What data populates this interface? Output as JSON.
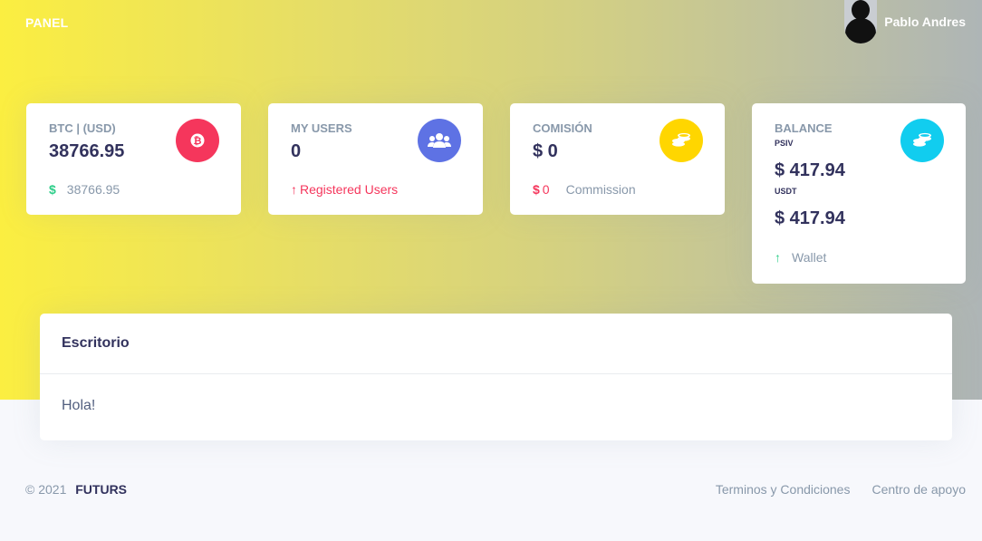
{
  "header": {
    "brand": "PANEL",
    "user_name": "Pablo Andres"
  },
  "stats": {
    "btc": {
      "title": "BTC | (USD)",
      "value": "38766.95",
      "foot_symbol": "$",
      "foot_text": "38766.95",
      "icon": "bitcoin-icon",
      "icon_color": "#f5365c"
    },
    "users": {
      "title": "MY USERS",
      "value": "0",
      "foot_symbol": "↑",
      "foot_text": "Registered Users",
      "icon": "users-icon",
      "icon_color": "#5e72e4"
    },
    "commission": {
      "title": "COMISIÓN",
      "value": "$ 0",
      "foot_symbol": "$",
      "foot_amount": "0",
      "foot_text": "Commission",
      "icon": "coins-icon",
      "icon_color": "#ffd600"
    },
    "balance": {
      "title": "BALANCE",
      "psiv_label": "PSIV",
      "psiv_value": "$ 417.94",
      "usdt_label": "USDT",
      "usdt_value": "$ 417.94",
      "foot_symbol": "↑",
      "foot_text": "Wallet",
      "icon": "coins-icon",
      "icon_color": "#11cdef"
    }
  },
  "panel": {
    "title": "Escritorio",
    "body": "Hola!"
  },
  "footer": {
    "copyright": "© 2021",
    "brand": "FUTURS",
    "links": [
      "Terminos y Condiciones",
      "Centro de apoyo"
    ]
  },
  "colors": {
    "danger": "#f5365c",
    "success": "#2dce89",
    "muted": "#8898aa"
  }
}
